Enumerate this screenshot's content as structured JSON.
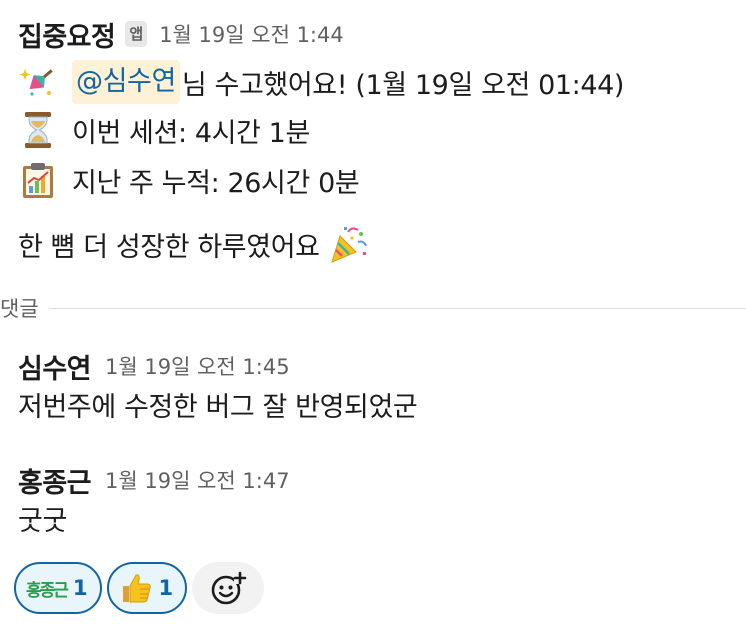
{
  "message": {
    "sender": "집중요정",
    "app_badge": "앱",
    "timestamp": "1월 19일 오전 1:44",
    "line1": {
      "emoji": "sparkle-wand",
      "mention": "@심수연",
      "text": "님 수고했어요! (1월 19일 오전 01:44)"
    },
    "line2": {
      "emoji": "hourglass",
      "text": "이번 세션: 4시간 1분"
    },
    "line3": {
      "emoji": "chart-clipboard",
      "text": "지난 주 누적: 26시간 0분"
    },
    "line4": {
      "text": "한 뼘 더 성장한 하루였어요",
      "emoji": "party-popper"
    }
  },
  "divider": {
    "label": "댓글"
  },
  "replies": [
    {
      "sender": "심수연",
      "timestamp": "1월 19일 오전 1:45",
      "text": "저번주에 수정한 버그 잘 반영되었군"
    },
    {
      "sender": "홍종근",
      "timestamp": "1월 19일 오전 1:47",
      "text": "굿굿"
    }
  ],
  "reactions": [
    {
      "emoji_text": "홍종근",
      "emoji": "custom-name-emoji",
      "count": "1"
    },
    {
      "emoji": "thumbs-up",
      "count": "1"
    }
  ],
  "add_reaction_icon": "add-reaction-icon",
  "colors": {
    "accent": "#1264a3",
    "mention_bg": "#fdf1d6",
    "reaction_bg": "#e8f5fa",
    "muted_text": "#616061",
    "text": "#1d1c1d"
  }
}
